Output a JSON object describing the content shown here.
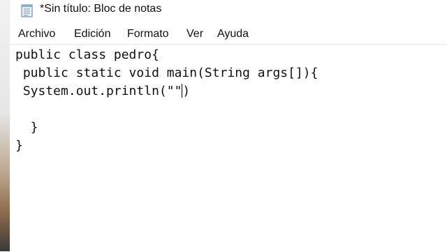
{
  "window": {
    "title": "*Sin título: Bloc de notas",
    "app_icon": "notepad-icon"
  },
  "menu": {
    "items": [
      {
        "label": "Archivo"
      },
      {
        "label": "Edición"
      },
      {
        "label": "Formato"
      },
      {
        "label": "Ver"
      },
      {
        "label": "Ayuda"
      }
    ]
  },
  "editor": {
    "lines": [
      "public class pedro{",
      " public static void main(String args[]){",
      " System.out.println(\"\"",
      "",
      "  }",
      "}"
    ],
    "line3_after_caret": ")"
  },
  "colors": {
    "background": "#ffffff",
    "text": "#111111"
  }
}
